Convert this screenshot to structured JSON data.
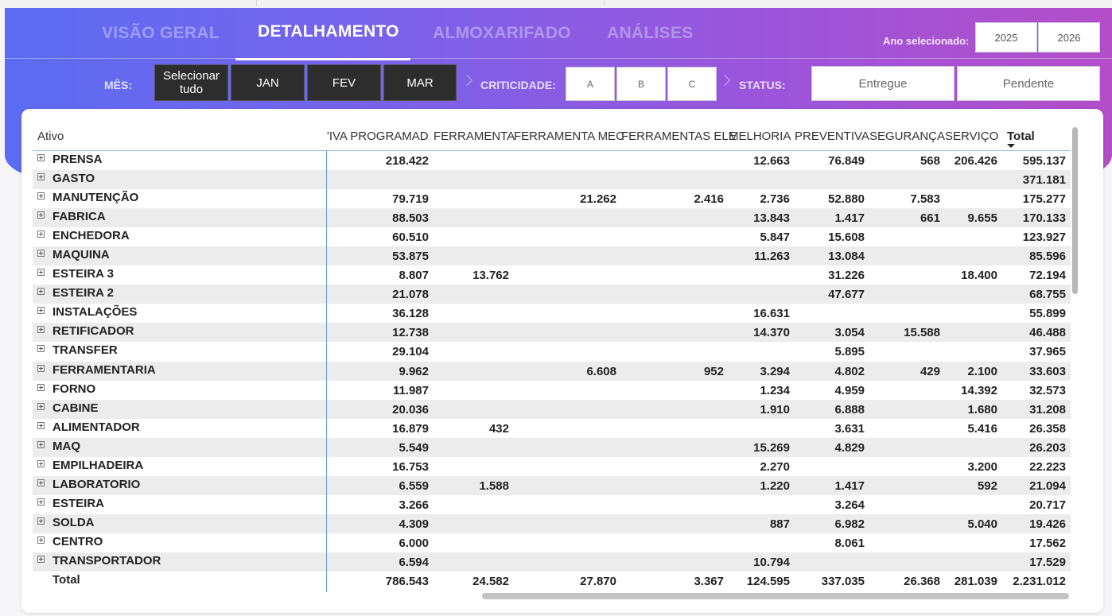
{
  "nav": {
    "tabs": [
      {
        "label": "VISÃO GERAL"
      },
      {
        "label": "DETALHAMENTO"
      },
      {
        "label": "ALMOXARIFADO"
      },
      {
        "label": "ANÁLISES"
      }
    ],
    "active_tab": "DETALHAMENTO",
    "year_label": "Ano selecionado:",
    "years": [
      "2025",
      "2026"
    ]
  },
  "filters": {
    "mes_label": "MÊS:",
    "months": [
      "Selecionar tudo",
      "JAN",
      "FEV",
      "MAR"
    ],
    "criticidade_label": "CRITICIDADE:",
    "criticidade": [
      "A",
      "B",
      "C"
    ],
    "status_label": "STATUS:",
    "status": [
      "Entregue",
      "Pendente"
    ]
  },
  "table": {
    "row_header": "Ativo",
    "columns": [
      "'IVA PROGRAMADA",
      "FERRAMENTA",
      "FERRAMENTA MEC",
      "FERRAMENTAS ELE",
      "MELHORIA",
      "PREVENTIVA",
      "SEGURANÇA",
      "SERVIÇO",
      "Total"
    ],
    "rows": [
      {
        "name": "PRENSA",
        "values": [
          "218.422",
          "",
          "",
          "",
          "12.663",
          "76.849",
          "568",
          "206.426",
          "595.137"
        ]
      },
      {
        "name": "GASTO",
        "values": [
          "",
          "",
          "",
          "",
          "",
          "",
          "",
          "",
          "371.181"
        ]
      },
      {
        "name": "MANUTENÇÃO",
        "values": [
          "79.719",
          "",
          "21.262",
          "2.416",
          "2.736",
          "52.880",
          "7.583",
          "",
          "175.277"
        ]
      },
      {
        "name": "FABRICA",
        "values": [
          "88.503",
          "",
          "",
          "",
          "13.843",
          "1.417",
          "661",
          "9.655",
          "170.133"
        ]
      },
      {
        "name": "ENCHEDORA",
        "values": [
          "60.510",
          "",
          "",
          "",
          "5.847",
          "15.608",
          "",
          "",
          "123.927"
        ]
      },
      {
        "name": "MAQUINA",
        "values": [
          "53.875",
          "",
          "",
          "",
          "11.263",
          "13.084",
          "",
          "",
          "85.596"
        ]
      },
      {
        "name": "ESTEIRA 3",
        "values": [
          "8.807",
          "13.762",
          "",
          "",
          "",
          "31.226",
          "",
          "18.400",
          "72.194"
        ]
      },
      {
        "name": "ESTEIRA 2",
        "values": [
          "21.078",
          "",
          "",
          "",
          "",
          "47.677",
          "",
          "",
          "68.755"
        ]
      },
      {
        "name": "INSTALAÇÕES",
        "values": [
          "36.128",
          "",
          "",
          "",
          "16.631",
          "",
          "",
          "",
          "55.899"
        ]
      },
      {
        "name": "RETIFICADOR",
        "values": [
          "12.738",
          "",
          "",
          "",
          "14.370",
          "3.054",
          "15.588",
          "",
          "46.488"
        ]
      },
      {
        "name": "TRANSFER",
        "values": [
          "29.104",
          "",
          "",
          "",
          "",
          "5.895",
          "",
          "",
          "37.965"
        ]
      },
      {
        "name": "FERRAMENTARIA",
        "values": [
          "9.962",
          "",
          "6.608",
          "952",
          "3.294",
          "4.802",
          "429",
          "2.100",
          "33.603"
        ]
      },
      {
        "name": "FORNO",
        "values": [
          "11.987",
          "",
          "",
          "",
          "1.234",
          "4.959",
          "",
          "14.392",
          "32.573"
        ]
      },
      {
        "name": "CABINE",
        "values": [
          "20.036",
          "",
          "",
          "",
          "1.910",
          "6.888",
          "",
          "1.680",
          "31.208"
        ]
      },
      {
        "name": "ALIMENTADOR",
        "values": [
          "16.879",
          "432",
          "",
          "",
          "",
          "3.631",
          "",
          "5.416",
          "26.358"
        ]
      },
      {
        "name": "MAQ",
        "values": [
          "5.549",
          "",
          "",
          "",
          "15.269",
          "4.829",
          "",
          "",
          "26.203"
        ]
      },
      {
        "name": "EMPILHADEIRA",
        "values": [
          "16.753",
          "",
          "",
          "",
          "2.270",
          "",
          "",
          "3.200",
          "22.223"
        ]
      },
      {
        "name": "LABORATORIO",
        "values": [
          "6.559",
          "1.588",
          "",
          "",
          "1.220",
          "1.417",
          "",
          "592",
          "21.094"
        ]
      },
      {
        "name": "ESTEIRA",
        "values": [
          "3.266",
          "",
          "",
          "",
          "",
          "3.264",
          "",
          "",
          "20.717"
        ]
      },
      {
        "name": "SOLDA",
        "values": [
          "4.309",
          "",
          "",
          "",
          "887",
          "6.982",
          "",
          "5.040",
          "19.426"
        ]
      },
      {
        "name": "CENTRO",
        "values": [
          "6.000",
          "",
          "",
          "",
          "",
          "8.061",
          "",
          "",
          "17.562"
        ]
      },
      {
        "name": "TRANSPORTADOR",
        "values": [
          "6.594",
          "",
          "",
          "",
          "10.794",
          "",
          "",
          "",
          "17.529"
        ]
      }
    ],
    "total_row": {
      "name": "Total",
      "values": [
        "786.543",
        "24.582",
        "27.870",
        "3.367",
        "124.595",
        "337.035",
        "26.368",
        "281.039",
        "2.231.012"
      ]
    }
  }
}
